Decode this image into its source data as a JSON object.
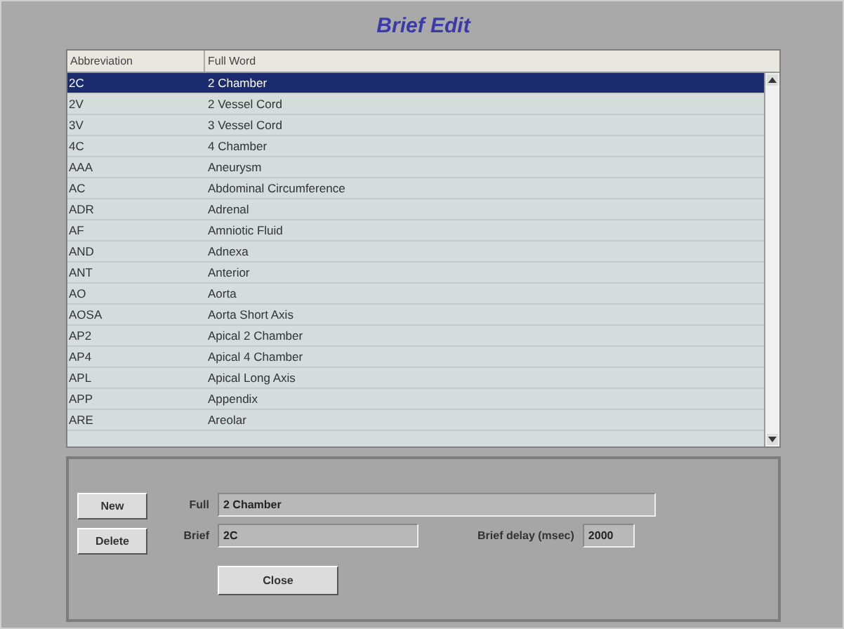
{
  "window": {
    "title": "Brief Edit"
  },
  "table": {
    "columns": [
      "Abbreviation",
      "Full Word"
    ],
    "rows": [
      {
        "abbreviation": "2C",
        "full_word": "2 Chamber",
        "selected": true
      },
      {
        "abbreviation": "2V",
        "full_word": "2 Vessel Cord",
        "selected": false
      },
      {
        "abbreviation": "3V",
        "full_word": "3 Vessel Cord",
        "selected": false
      },
      {
        "abbreviation": "4C",
        "full_word": "4 Chamber",
        "selected": false
      },
      {
        "abbreviation": "AAA",
        "full_word": "Aneurysm",
        "selected": false
      },
      {
        "abbreviation": "AC",
        "full_word": "Abdominal Circumference",
        "selected": false
      },
      {
        "abbreviation": "ADR",
        "full_word": "Adrenal",
        "selected": false
      },
      {
        "abbreviation": "AF",
        "full_word": "Amniotic Fluid",
        "selected": false
      },
      {
        "abbreviation": "AND",
        "full_word": "Adnexa",
        "selected": false
      },
      {
        "abbreviation": "ANT",
        "full_word": "Anterior",
        "selected": false
      },
      {
        "abbreviation": "AO",
        "full_word": "Aorta",
        "selected": false
      },
      {
        "abbreviation": "AOSA",
        "full_word": "Aorta Short Axis",
        "selected": false
      },
      {
        "abbreviation": "AP2",
        "full_word": "Apical 2 Chamber",
        "selected": false
      },
      {
        "abbreviation": "AP4",
        "full_word": "Apical 4 Chamber",
        "selected": false
      },
      {
        "abbreviation": "APL",
        "full_word": "Apical Long Axis",
        "selected": false
      },
      {
        "abbreviation": "APP",
        "full_word": "Appendix",
        "selected": false
      },
      {
        "abbreviation": "ARE",
        "full_word": "Areolar",
        "selected": false
      }
    ]
  },
  "buttons": {
    "new": "New",
    "delete": "Delete",
    "close": "Close"
  },
  "form": {
    "full_label": "Full",
    "full_value": "2 Chamber",
    "brief_label": "Brief",
    "brief_value": "2C",
    "delay_label": "Brief delay (msec)",
    "delay_value": "2000"
  }
}
